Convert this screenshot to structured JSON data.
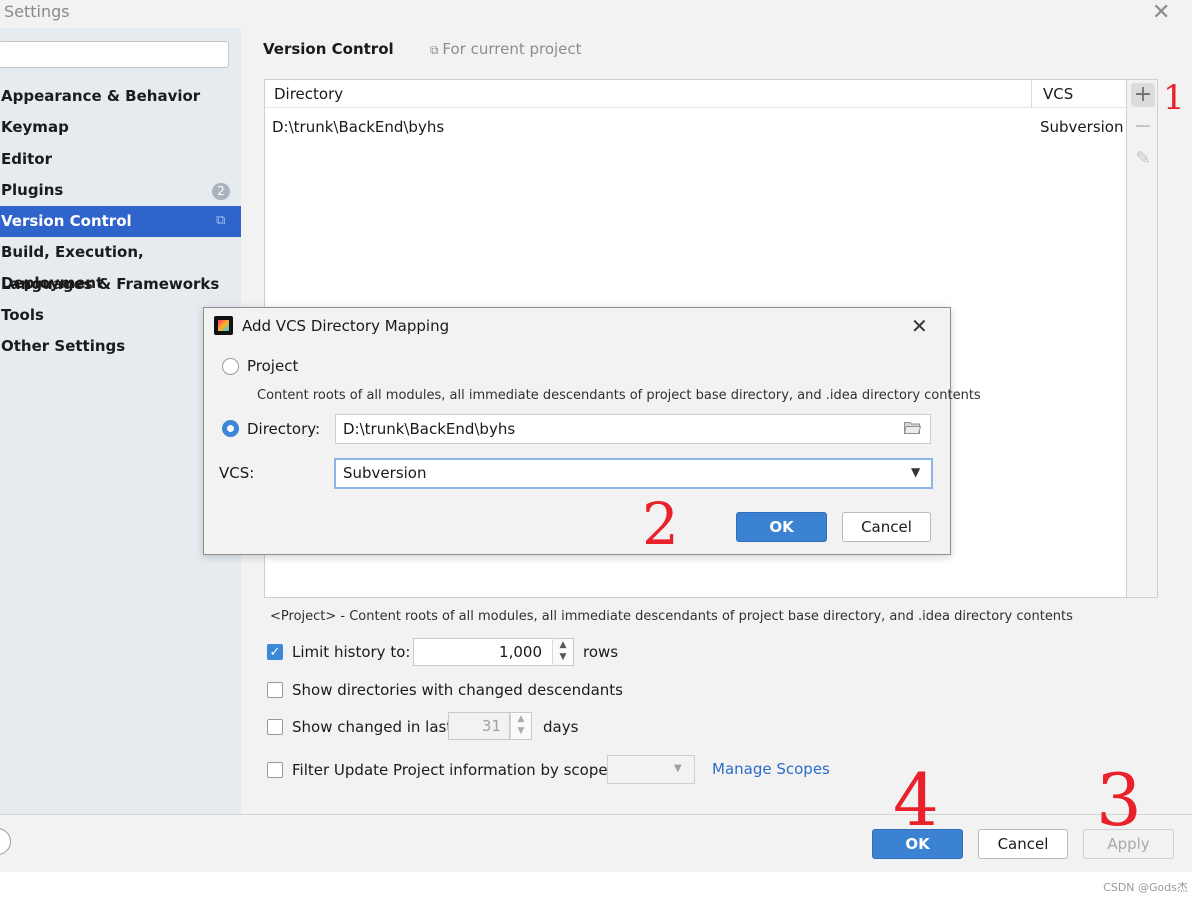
{
  "window": {
    "title": "Settings"
  },
  "sidebar": {
    "items": [
      {
        "label": "Appearance & Behavior"
      },
      {
        "label": "Keymap"
      },
      {
        "label": "Editor"
      },
      {
        "label": "Plugins",
        "badge": "2"
      },
      {
        "label": "Version Control",
        "selected": true,
        "icon": "copy-icon"
      },
      {
        "label": "Build, Execution, Deployment"
      },
      {
        "label": "Languages & Frameworks"
      },
      {
        "label": "Tools"
      },
      {
        "label": "Other Settings"
      }
    ]
  },
  "content": {
    "title": "Version Control",
    "project_note": "For current project",
    "table": {
      "columns": [
        "Directory",
        "VCS"
      ],
      "rows": [
        {
          "directory": "D:\\trunk\\BackEnd\\byhs",
          "vcs": "Subversion"
        }
      ]
    },
    "toolbar": {
      "add": "+",
      "remove": "−",
      "edit": "✎"
    },
    "project_description": "<Project> - Content roots of all modules, all immediate descendants of project base directory, and .idea directory contents",
    "options": {
      "limit_history": {
        "label": "Limit history to:",
        "checked": true,
        "value": "1,000",
        "suffix": "rows"
      },
      "show_dirs": {
        "label": "Show directories with changed descendants",
        "checked": false
      },
      "show_changed": {
        "label": "Show changed in last",
        "checked": false,
        "value": "31",
        "suffix": "days"
      },
      "filter_scope": {
        "label": "Filter Update Project information by scope",
        "checked": false,
        "selected": ""
      },
      "manage_scopes": "Manage Scopes"
    }
  },
  "footer": {
    "ok": "OK",
    "cancel": "Cancel",
    "apply": "Apply"
  },
  "dialog": {
    "title": "Add VCS Directory Mapping",
    "project_label": "Project",
    "project_description": "Content roots of all modules, all immediate descendants of project base directory, and .idea directory contents",
    "directory_label": "Directory:",
    "directory_value": "D:\\trunk\\BackEnd\\byhs",
    "vcs_label": "VCS:",
    "vcs_value": "Subversion",
    "ok": "OK",
    "cancel": "Cancel",
    "selected_option": "Directory"
  },
  "annotations": [
    "1",
    "2",
    "3",
    "4"
  ],
  "watermark": "CSDN @Gods杰",
  "colors": {
    "accent": "#2f65ca",
    "primary_button": "#3c82d3",
    "link": "#2c6ec7",
    "annotation": "#e8212a"
  }
}
